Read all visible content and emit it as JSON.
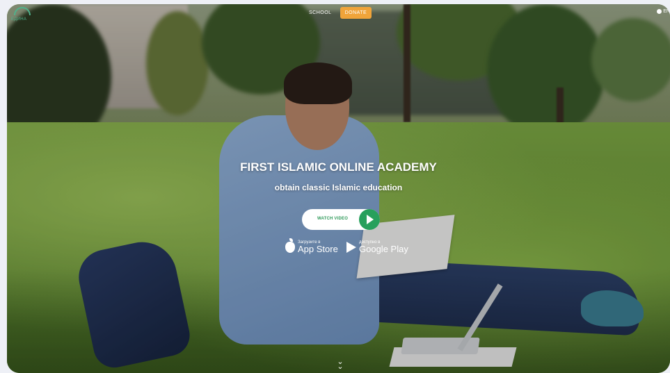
{
  "header": {
    "logo_text": "ЕДИНА",
    "nav": [
      {
        "label": "SCHOOL"
      },
      {
        "label": "DONATE"
      }
    ],
    "language": "EN"
  },
  "hero": {
    "title": "FIRST ISLAMIC ONLINE ACADEMY",
    "subtitle": "obtain classic Islamic education",
    "watch_button_label": "WATCH VIDEO"
  },
  "stores": {
    "apple": {
      "small": "Загрузите в",
      "big": "App Store"
    },
    "google": {
      "small": "доступно в",
      "big": "Google Play"
    }
  },
  "colors": {
    "accent_green": "#27a05c",
    "donate_orange": "#f0a43a",
    "logo_green": "#4fb28c"
  },
  "icons": {
    "logo": "academy-logo-icon",
    "globe": "globe-icon",
    "play": "play-icon",
    "apple": "apple-icon",
    "google_play": "google-play-icon",
    "scroll": "chevron-down-icon"
  }
}
